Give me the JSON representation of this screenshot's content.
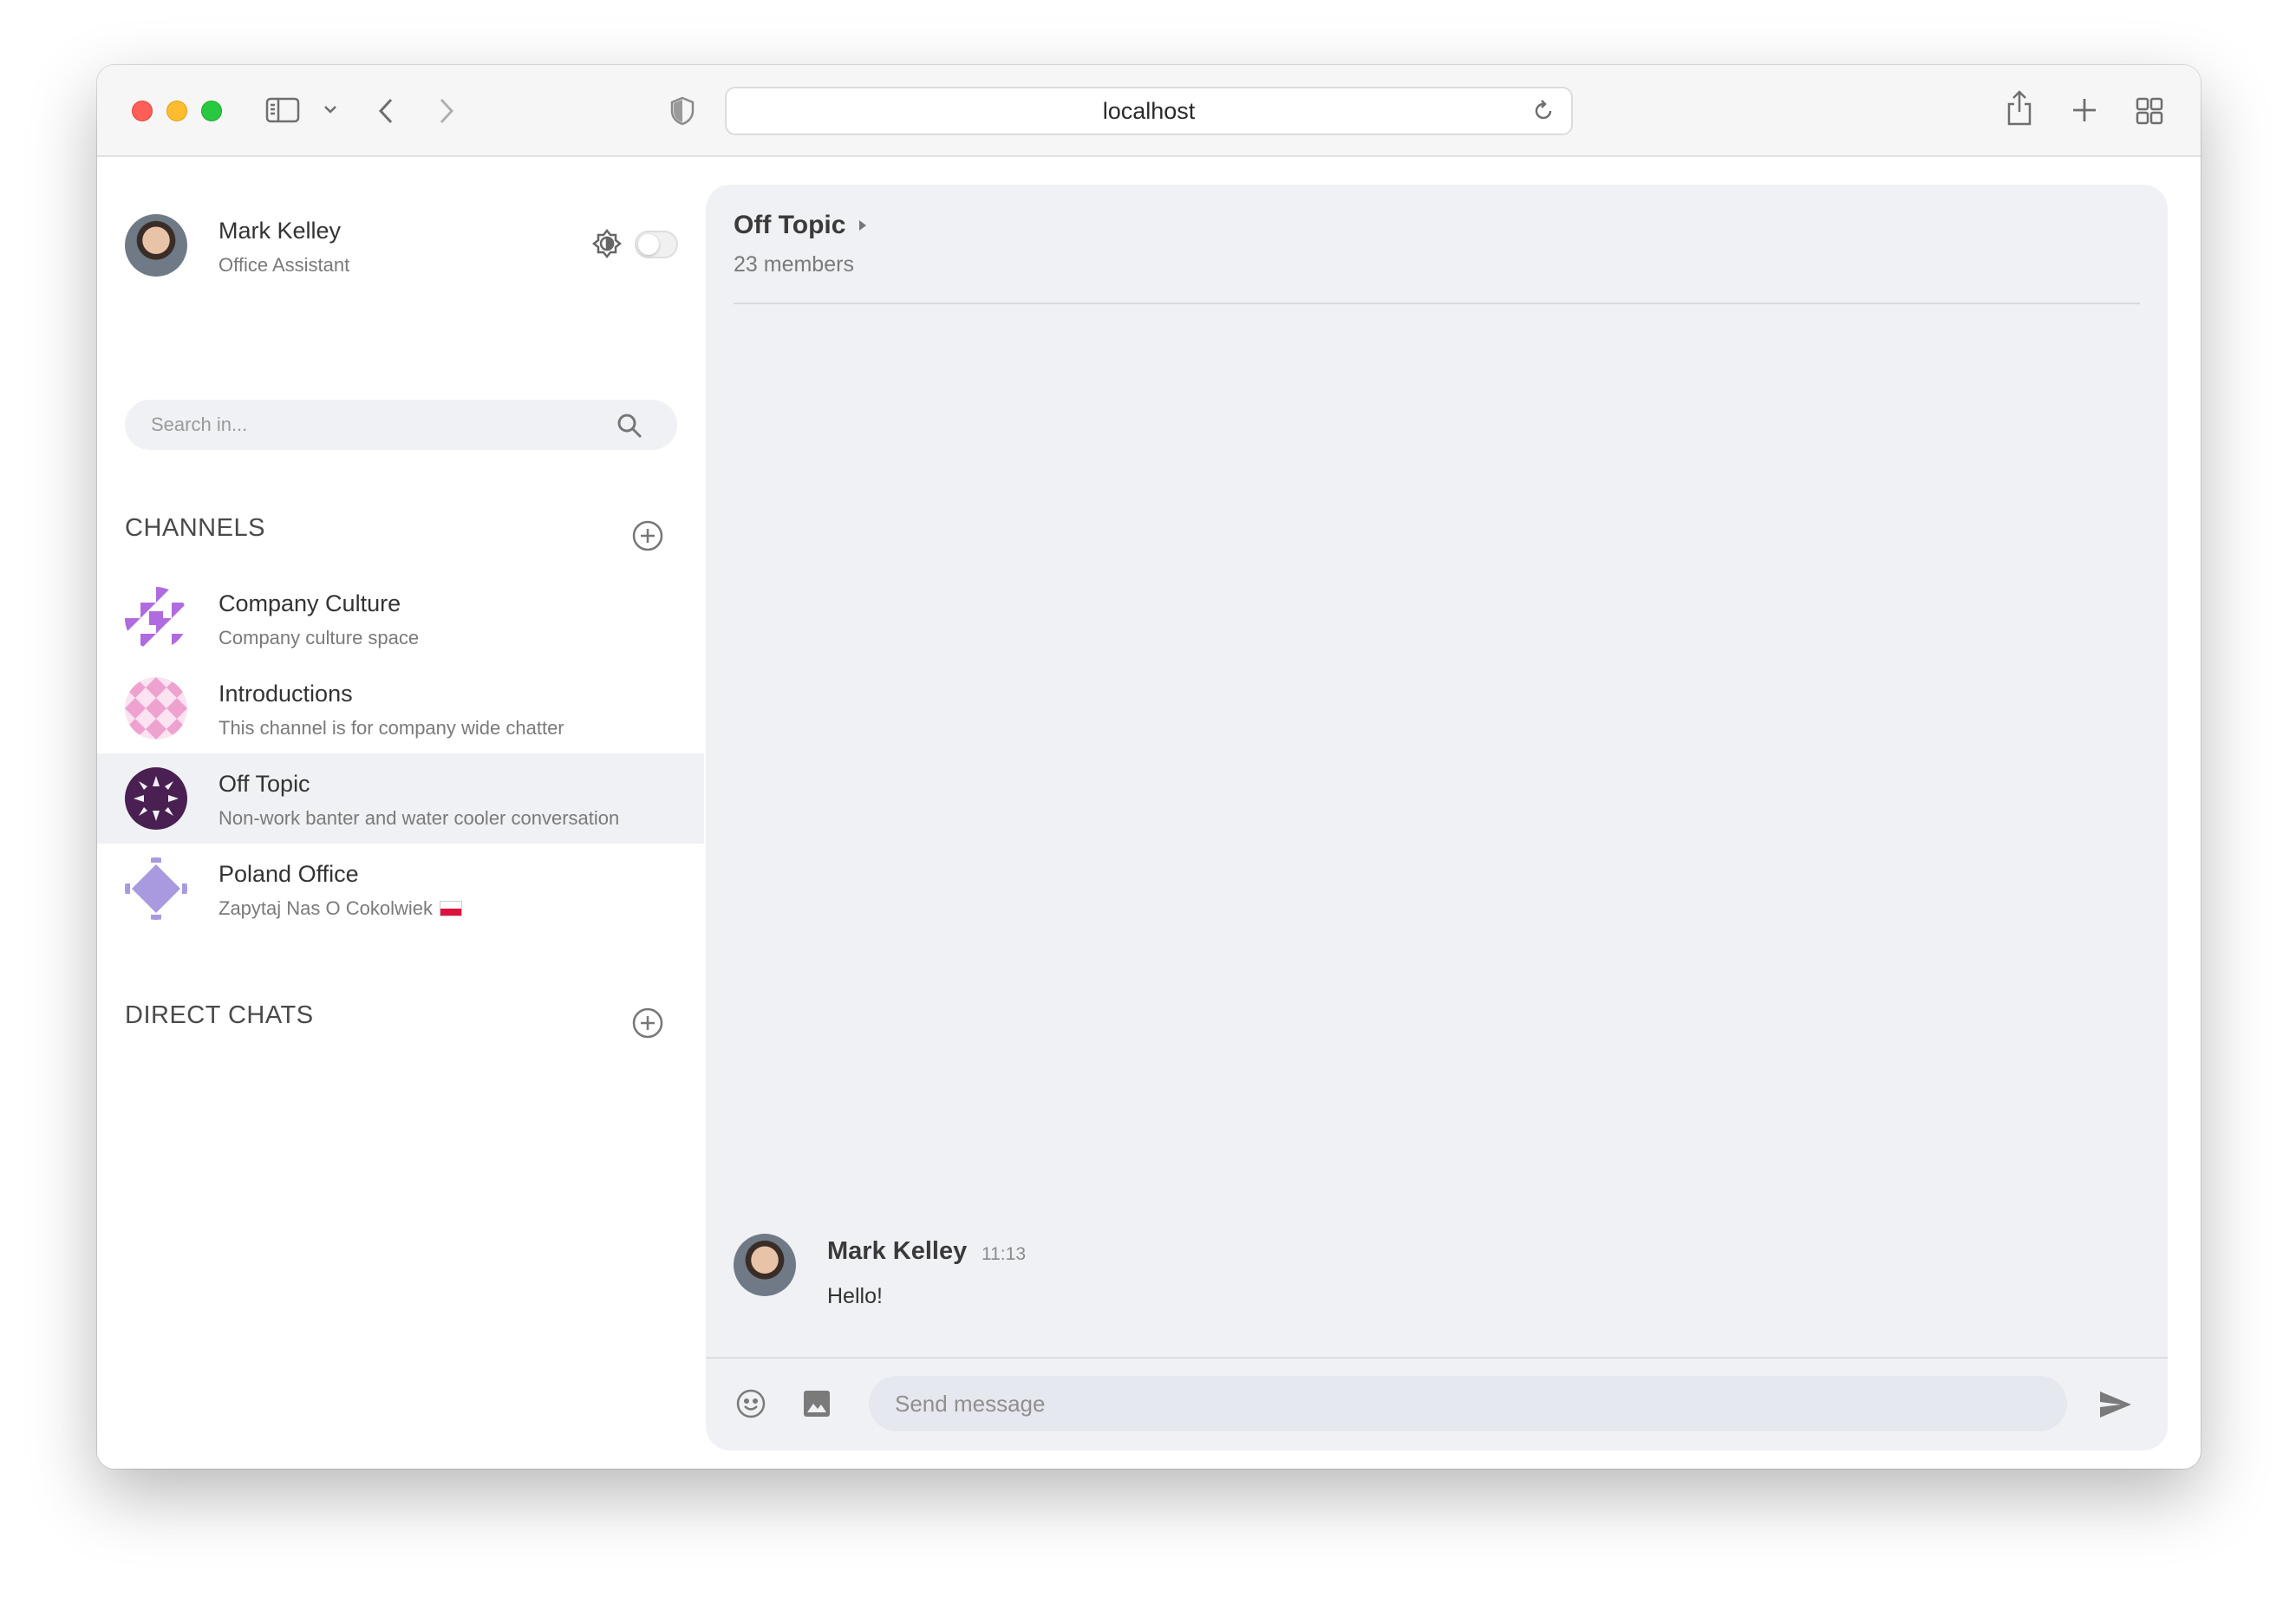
{
  "browser": {
    "url": "localhost"
  },
  "user": {
    "name": "Mark Kelley",
    "role": "Office Assistant"
  },
  "search": {
    "placeholder": "Search in..."
  },
  "channels_section": {
    "title": "CHANNELS"
  },
  "channels": [
    {
      "name": "Company Culture",
      "description": "Company culture space",
      "color": "#b06be0"
    },
    {
      "name": "Introductions",
      "description": "This channel is for company wide chatter",
      "color": "#eea2cf"
    },
    {
      "name": "Off Topic",
      "description": "Non-work banter and water cooler conversation",
      "color": "#4a1f52"
    },
    {
      "name": "Poland Office",
      "description": "Zapytaj Nas O Cokolwiek",
      "color": "#a999de"
    }
  ],
  "direct_chats_section": {
    "title": "DIRECT CHATS"
  },
  "room": {
    "title": "Off Topic",
    "members": "23 members"
  },
  "messages": [
    {
      "author": "Mark Kelley",
      "time": "11:13",
      "text": "Hello!"
    }
  ],
  "composer": {
    "placeholder": "Send message"
  },
  "colors": {
    "sidebar_active": "#f0f1f5",
    "main_bg": "#f0f1f5"
  }
}
